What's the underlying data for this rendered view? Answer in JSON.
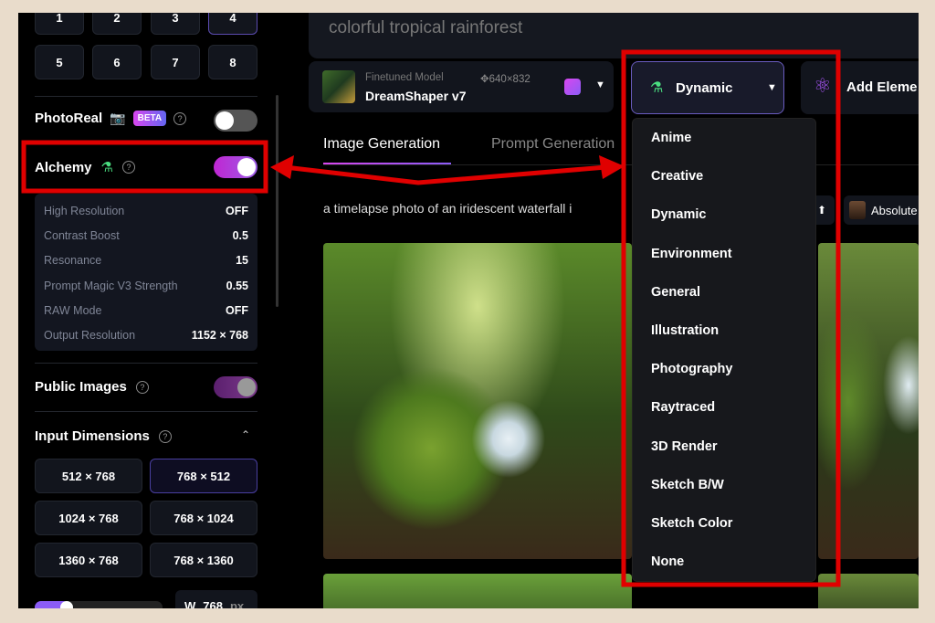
{
  "sidebar": {
    "image_counts": [
      "1",
      "2",
      "3",
      "4",
      "5",
      "6",
      "7",
      "8"
    ],
    "selected_count": "4",
    "photoreal": {
      "label": "PhotoReal",
      "badge": "BETA",
      "help": "?",
      "enabled": false
    },
    "alchemy": {
      "label": "Alchemy",
      "help": "?",
      "enabled": true,
      "settings": [
        {
          "name": "High Resolution",
          "value": "OFF"
        },
        {
          "name": "Contrast Boost",
          "value": "0.5"
        },
        {
          "name": "Resonance",
          "value": "15"
        },
        {
          "name": "Prompt Magic V3 Strength",
          "value": "0.55"
        },
        {
          "name": "RAW Mode",
          "value": "OFF"
        },
        {
          "name": "Output Resolution",
          "value": "1152 × 768"
        }
      ]
    },
    "public_images": {
      "label": "Public Images",
      "help": "?",
      "enabled": true
    },
    "input_dimensions": {
      "label": "Input Dimensions",
      "help": "?",
      "options": [
        "512 × 768",
        "768 × 512",
        "1024 × 768",
        "768 × 1024",
        "1360 × 768",
        "768 × 1360"
      ],
      "selected": "768 × 512"
    },
    "width_field": {
      "label": "W",
      "value": "768",
      "unit": "px"
    }
  },
  "main": {
    "prompt_text": "colorful tropical rainforest",
    "model": {
      "caption": "Finetuned Model",
      "size": "640×832",
      "name": "DreamShaper v7"
    },
    "style_dropdown": {
      "selected": "Dynamic",
      "options": [
        "Anime",
        "Creative",
        "Dynamic",
        "Environment",
        "General",
        "Illustration",
        "Photography",
        "Raytraced",
        "3D Render",
        "Sketch B/W",
        "Sketch Color",
        "None"
      ]
    },
    "add_elements_label": "Add Eleme",
    "tabs": [
      {
        "label": "Image Generation",
        "active": true
      },
      {
        "label": "Prompt Generation",
        "active": false
      }
    ],
    "generation_prompt": "a timelapse photo of an iridescent waterfall i",
    "model_chip": "Absolute"
  },
  "colors": {
    "accent": "#a855f7",
    "highlight": "#e00000",
    "background": "#000000"
  }
}
